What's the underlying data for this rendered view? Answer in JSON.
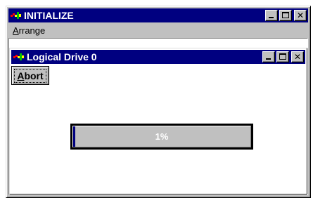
{
  "window": {
    "title": "INITIALIZE",
    "icon": "app-icon",
    "controls": [
      "minimize-icon",
      "maximize-icon",
      "close-icon"
    ],
    "title_color": "#000080"
  },
  "menubar": {
    "items": [
      {
        "label_prefix": "A",
        "label_rest": "rrange"
      }
    ]
  },
  "child_window": {
    "title": "Logical Drive 0",
    "icon": "app-icon",
    "controls": [
      "minimize-icon",
      "maximize-icon",
      "close-icon"
    ]
  },
  "abort_button": {
    "label_prefix": "A",
    "label_rest": "bort"
  },
  "progress": {
    "value_percent": 1,
    "label": "1%",
    "fill_color": "#000080"
  }
}
